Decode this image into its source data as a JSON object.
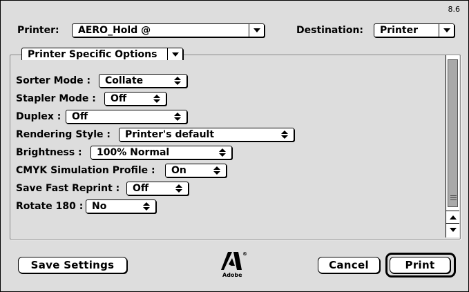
{
  "header": {
    "version": "8.6",
    "printer_label": "Printer:",
    "printer_value": "AERO_Hold @",
    "destination_label": "Destination:",
    "destination_value": "Printer"
  },
  "section": {
    "selector_value": "Printer Specific Options"
  },
  "options": [
    {
      "label": "Sorter Mode :",
      "value": "Collate"
    },
    {
      "label": "Stapler Mode :",
      "value": "Off"
    },
    {
      "label": "Duplex :",
      "value": "Off"
    },
    {
      "label": "Rendering Style :",
      "value": "Printer's default"
    },
    {
      "label": "Brightness :",
      "value": "100% Normal"
    },
    {
      "label": "CMYK Simulation Profile :",
      "value": "On"
    },
    {
      "label": "Save Fast Reprint :",
      "value": "Off"
    },
    {
      "label": "Rotate 180 :",
      "value": "No"
    }
  ],
  "buttons": {
    "save_settings": "Save Settings",
    "cancel": "Cancel",
    "print": "Print"
  },
  "logo": {
    "text": "Adobe"
  }
}
